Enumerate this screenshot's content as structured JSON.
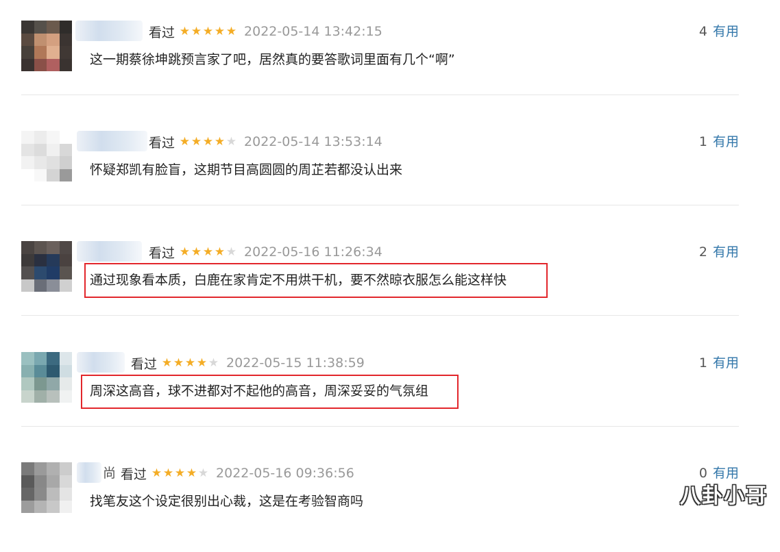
{
  "reviews": [
    {
      "name_tail": "",
      "watched": "看过",
      "stars": 5,
      "time": "2022-05-14 13:42:15",
      "useful_count": "4",
      "useful_label": "有用",
      "comment": "这一期蔡徐坤跳预言家了吧，居然真的要答歌词里面有几个“啊”",
      "highlighted": false
    },
    {
      "name_tail": "",
      "watched": "看过",
      "stars": 4,
      "time": "2022-05-14 13:53:14",
      "useful_count": "1",
      "useful_label": "有用",
      "comment": "怀疑郑凯有脸盲，这期节目高圆圆的周芷若都没认出来",
      "highlighted": false
    },
    {
      "name_tail": "",
      "watched": "看过",
      "stars": 4,
      "time": "2022-05-16 11:26:34",
      "useful_count": "2",
      "useful_label": "有用",
      "comment": "通过现象看本质，白鹿在家肯定不用烘干机，要不然晾衣服怎么能这样快",
      "highlighted": true
    },
    {
      "name_tail": "",
      "watched": "看过",
      "stars": 4,
      "time": "2022-05-15 11:38:59",
      "useful_count": "1",
      "useful_label": "有用",
      "comment": "周深这高音，球不进都对不起他的高音，周深妥妥的气氛组",
      "highlighted": true
    },
    {
      "name_tail": "尚",
      "watched": "看过",
      "stars": 4,
      "time": "2022-05-16 09:36:56",
      "useful_count": "0",
      "useful_label": "有用",
      "comment": "找笔友这个设定很别出心裁，这是在考验智商吗",
      "highlighted": false
    }
  ],
  "watermark": "八卦小哥",
  "colors": {
    "star_on": "#f4ad26",
    "star_off": "#d8d8d8",
    "useful_link": "#3377aa",
    "timestamp": "#999999",
    "highlight_box": "#e2262b"
  }
}
